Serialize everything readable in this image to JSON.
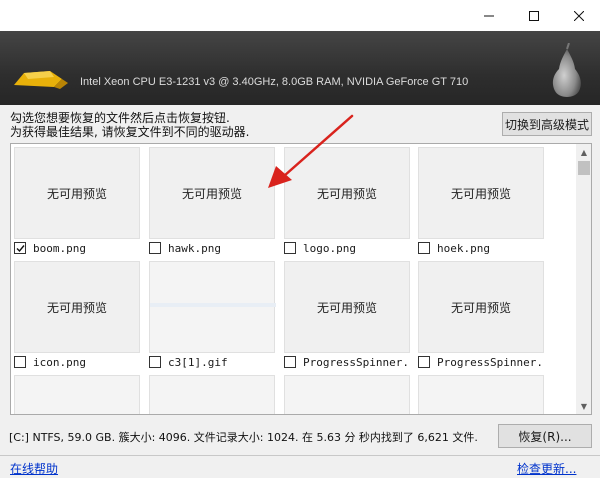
{
  "header": {
    "sysinfo": "Intel Xeon CPU E3-1231 v3 @ 3.40GHz, 8.0GB RAM, NVIDIA GeForce GT 710"
  },
  "instructions": {
    "line1": "勾选您想要恢复的文件然后点击恢复按钮.",
    "line2": "为获得最佳结果, 请恢复文件到不同的驱动器."
  },
  "toolbar": {
    "advanced_mode_label": "切换到高级模式"
  },
  "grid": {
    "no_preview_text": "无可用预览",
    "items": [
      {
        "name": "boom.png",
        "checked": true,
        "has_preview_text": true
      },
      {
        "name": "hawk.png",
        "checked": false,
        "has_preview_text": true
      },
      {
        "name": "logo.png",
        "checked": false,
        "has_preview_text": true
      },
      {
        "name": "hoek.png",
        "checked": false,
        "has_preview_text": true
      },
      {
        "name": "icon.png",
        "checked": false,
        "has_preview_text": true
      },
      {
        "name": "c3[1].gif",
        "checked": false,
        "has_preview_text": false
      },
      {
        "name": "ProgressSpinner...",
        "checked": false,
        "has_preview_text": true
      },
      {
        "name": "ProgressSpinner...",
        "checked": false,
        "has_preview_text": true
      }
    ]
  },
  "status": {
    "text": "[C:] NTFS, 59.0 GB. 簇大小: 4096. 文件记录大小: 1024. 在 5.63 分 秒内找到了 6,621 文件."
  },
  "actions": {
    "recover_label": "恢复(R)..."
  },
  "footer": {
    "help_link": "在线帮助",
    "update_link": "检查更新..."
  },
  "colors": {
    "header_bg": "#2e2e2e",
    "link": "#0033cc",
    "annotation_arrow": "#d9231d"
  }
}
